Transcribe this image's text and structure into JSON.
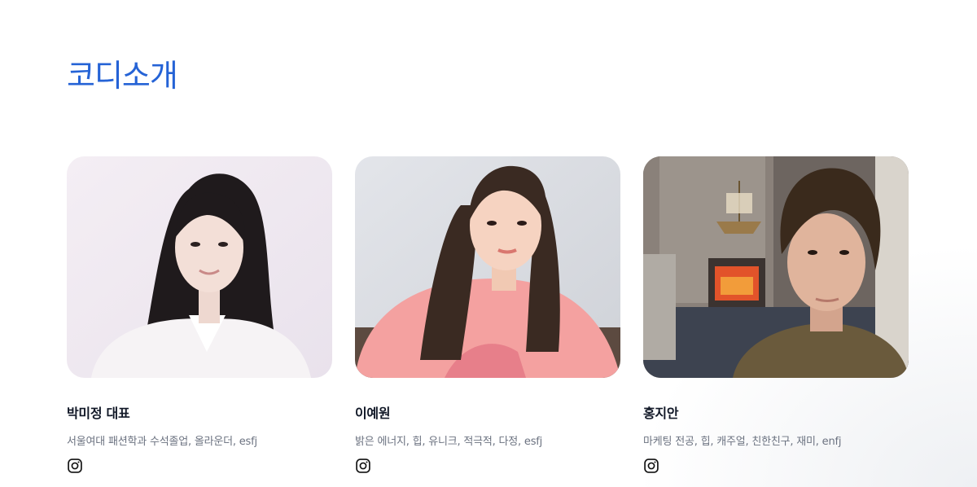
{
  "section": {
    "title": "코디소개"
  },
  "team": [
    {
      "name": "박미정 대표",
      "description": "서울여대 패션학과 수석졸업, 올라운더, esfj",
      "social_icon": "instagram-icon"
    },
    {
      "name": "이예원",
      "description": "밝은 에너지, 힙, 유니크, 적극적, 다정, esfj",
      "social_icon": "instagram-icon"
    },
    {
      "name": "홍지안",
      "description": "마케팅 전공, 힙, 캐주얼, 친한친구, 재미, enfj",
      "social_icon": "instagram-icon"
    }
  ],
  "colors": {
    "accent": "#2563d6",
    "name": "#111827",
    "desc": "#6b7280"
  }
}
